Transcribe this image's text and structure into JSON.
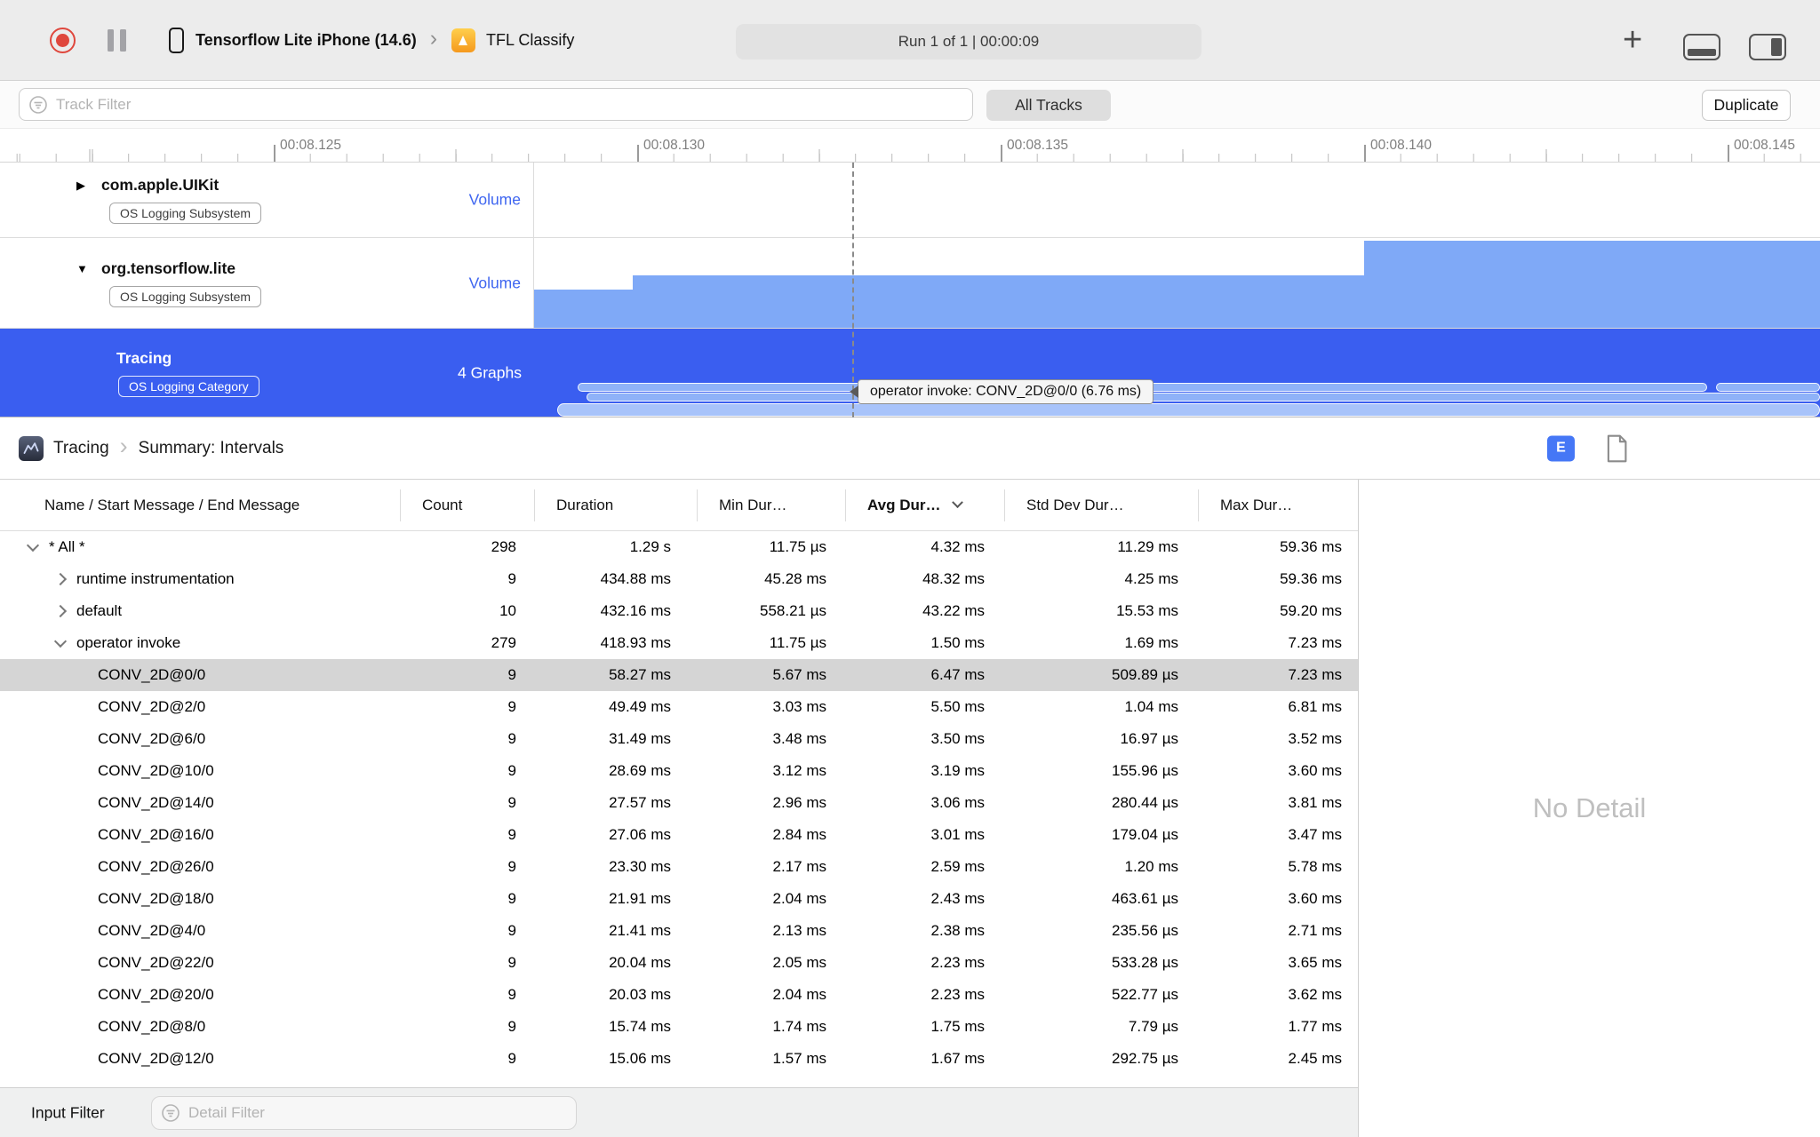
{
  "toolbar": {
    "device_name": "Tensorflow Lite iPhone (14.6)",
    "app_name": "TFL Classify",
    "run_status": "Run 1 of 1  |  00:00:09"
  },
  "filter_bar": {
    "track_filter_placeholder": "Track Filter",
    "all_tracks_label": "All Tracks",
    "duplicate_label": "Duplicate"
  },
  "ruler": {
    "ticks": [
      "00:08.125",
      "00:08.130",
      "00:08.135",
      "00:08.140",
      "00:08.145"
    ]
  },
  "tracks": {
    "uikit": {
      "name": "com.apple.UIKit",
      "badge": "OS Logging Subsystem",
      "detail": "Volume"
    },
    "tensorflow": {
      "name": "org.tensorflow.lite",
      "badge": "OS Logging Subsystem",
      "detail": "Volume"
    },
    "tracing": {
      "name": "Tracing",
      "badge": "OS Logging Category",
      "detail": "4 Graphs"
    }
  },
  "timeline": {
    "tooltip": "operator invoke: CONV_2D@0/0 (6.76 ms)"
  },
  "detail_header": {
    "instrument": "Tracing",
    "view": "Summary: Intervals",
    "e_button": "E"
  },
  "table": {
    "columns": [
      "Name / Start Message / End Message",
      "Count",
      "Duration",
      "Min Dur…",
      "Avg Dur…",
      "Std Dev Dur…",
      "Max Dur…"
    ],
    "rows": [
      {
        "name": "* All *",
        "count": "298",
        "duration": "1.29 s",
        "min": "11.75 µs",
        "avg": "4.32 ms",
        "std": "11.29 ms",
        "max": "59.36 ms",
        "level": 0,
        "chevron": "down",
        "selected": false
      },
      {
        "name": "runtime instrumentation",
        "count": "9",
        "duration": "434.88 ms",
        "min": "45.28 ms",
        "avg": "48.32 ms",
        "std": "4.25 ms",
        "max": "59.36 ms",
        "level": 1,
        "chevron": "right",
        "selected": false
      },
      {
        "name": "default",
        "count": "10",
        "duration": "432.16 ms",
        "min": "558.21 µs",
        "avg": "43.22 ms",
        "std": "15.53 ms",
        "max": "59.20 ms",
        "level": 1,
        "chevron": "right",
        "selected": false
      },
      {
        "name": "operator invoke",
        "count": "279",
        "duration": "418.93 ms",
        "min": "11.75 µs",
        "avg": "1.50 ms",
        "std": "1.69 ms",
        "max": "7.23 ms",
        "level": 1,
        "chevron": "down",
        "selected": false
      },
      {
        "name": "CONV_2D@0/0",
        "count": "9",
        "duration": "58.27 ms",
        "min": "5.67 ms",
        "avg": "6.47 ms",
        "std": "509.89 µs",
        "max": "7.23 ms",
        "level": 2,
        "chevron": "",
        "selected": true
      },
      {
        "name": "CONV_2D@2/0",
        "count": "9",
        "duration": "49.49 ms",
        "min": "3.03 ms",
        "avg": "5.50 ms",
        "std": "1.04 ms",
        "max": "6.81 ms",
        "level": 2,
        "chevron": "",
        "selected": false
      },
      {
        "name": "CONV_2D@6/0",
        "count": "9",
        "duration": "31.49 ms",
        "min": "3.48 ms",
        "avg": "3.50 ms",
        "std": "16.97 µs",
        "max": "3.52 ms",
        "level": 2,
        "chevron": "",
        "selected": false
      },
      {
        "name": "CONV_2D@10/0",
        "count": "9",
        "duration": "28.69 ms",
        "min": "3.12 ms",
        "avg": "3.19 ms",
        "std": "155.96 µs",
        "max": "3.60 ms",
        "level": 2,
        "chevron": "",
        "selected": false
      },
      {
        "name": "CONV_2D@14/0",
        "count": "9",
        "duration": "27.57 ms",
        "min": "2.96 ms",
        "avg": "3.06 ms",
        "std": "280.44 µs",
        "max": "3.81 ms",
        "level": 2,
        "chevron": "",
        "selected": false
      },
      {
        "name": "CONV_2D@16/0",
        "count": "9",
        "duration": "27.06 ms",
        "min": "2.84 ms",
        "avg": "3.01 ms",
        "std": "179.04 µs",
        "max": "3.47 ms",
        "level": 2,
        "chevron": "",
        "selected": false
      },
      {
        "name": "CONV_2D@26/0",
        "count": "9",
        "duration": "23.30 ms",
        "min": "2.17 ms",
        "avg": "2.59 ms",
        "std": "1.20 ms",
        "max": "5.78 ms",
        "level": 2,
        "chevron": "",
        "selected": false
      },
      {
        "name": "CONV_2D@18/0",
        "count": "9",
        "duration": "21.91 ms",
        "min": "2.04 ms",
        "avg": "2.43 ms",
        "std": "463.61 µs",
        "max": "3.60 ms",
        "level": 2,
        "chevron": "",
        "selected": false
      },
      {
        "name": "CONV_2D@4/0",
        "count": "9",
        "duration": "21.41 ms",
        "min": "2.13 ms",
        "avg": "2.38 ms",
        "std": "235.56 µs",
        "max": "2.71 ms",
        "level": 2,
        "chevron": "",
        "selected": false
      },
      {
        "name": "CONV_2D@22/0",
        "count": "9",
        "duration": "20.04 ms",
        "min": "2.05 ms",
        "avg": "2.23 ms",
        "std": "533.28 µs",
        "max": "3.65 ms",
        "level": 2,
        "chevron": "",
        "selected": false
      },
      {
        "name": "CONV_2D@20/0",
        "count": "9",
        "duration": "20.03 ms",
        "min": "2.04 ms",
        "avg": "2.23 ms",
        "std": "522.77 µs",
        "max": "3.62 ms",
        "level": 2,
        "chevron": "",
        "selected": false
      },
      {
        "name": "CONV_2D@8/0",
        "count": "9",
        "duration": "15.74 ms",
        "min": "1.74 ms",
        "avg": "1.75 ms",
        "std": "7.79 µs",
        "max": "1.77 ms",
        "level": 2,
        "chevron": "",
        "selected": false
      },
      {
        "name": "CONV_2D@12/0",
        "count": "9",
        "duration": "15.06 ms",
        "min": "1.57 ms",
        "avg": "1.67 ms",
        "std": "292.75 µs",
        "max": "2.45 ms",
        "level": 2,
        "chevron": "",
        "selected": false
      }
    ]
  },
  "inspector": {
    "empty_text": "No Detail"
  },
  "bottom_bar": {
    "label": "Input Filter",
    "detail_filter_placeholder": "Detail Filter"
  }
}
